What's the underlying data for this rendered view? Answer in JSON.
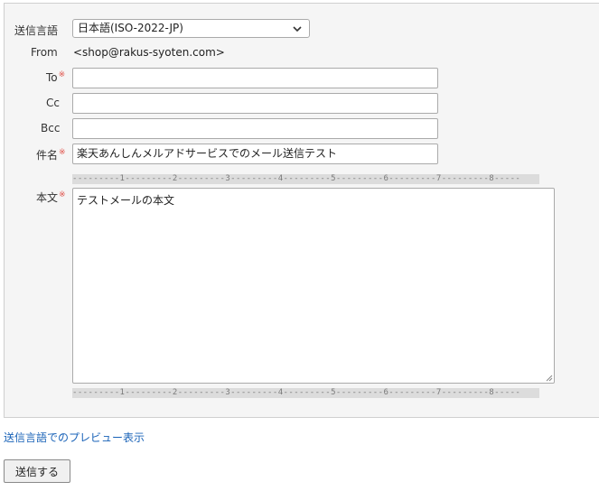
{
  "form": {
    "language_label": "送信言語",
    "language_value": "日本語(ISO-2022-JP)",
    "from_label": "From",
    "from_value": "<shop@rakus-syoten.com>",
    "to_label": "To",
    "to_value": "",
    "cc_label": "Cc",
    "cc_value": "",
    "bcc_label": "Bcc",
    "bcc_value": "",
    "subject_label": "件名",
    "subject_value": "楽天あんしんメルアドサービスでのメール送信テスト",
    "body_label": "本文",
    "body_value": "テストメールの本文",
    "required_mark": "※",
    "ruler_text": "---------1---------2---------3---------4---------5---------6---------7---------8-----"
  },
  "actions": {
    "preview_link": "送信言語でのプレビュー表示",
    "submit_label": "送信する"
  },
  "colors": {
    "panel_bg": "#f5f5f5",
    "required": "#e0524a",
    "link": "#1a63b8"
  },
  "icons": {
    "select_arrow": "chevron-down-icon",
    "resize": "resize-grip-icon"
  }
}
